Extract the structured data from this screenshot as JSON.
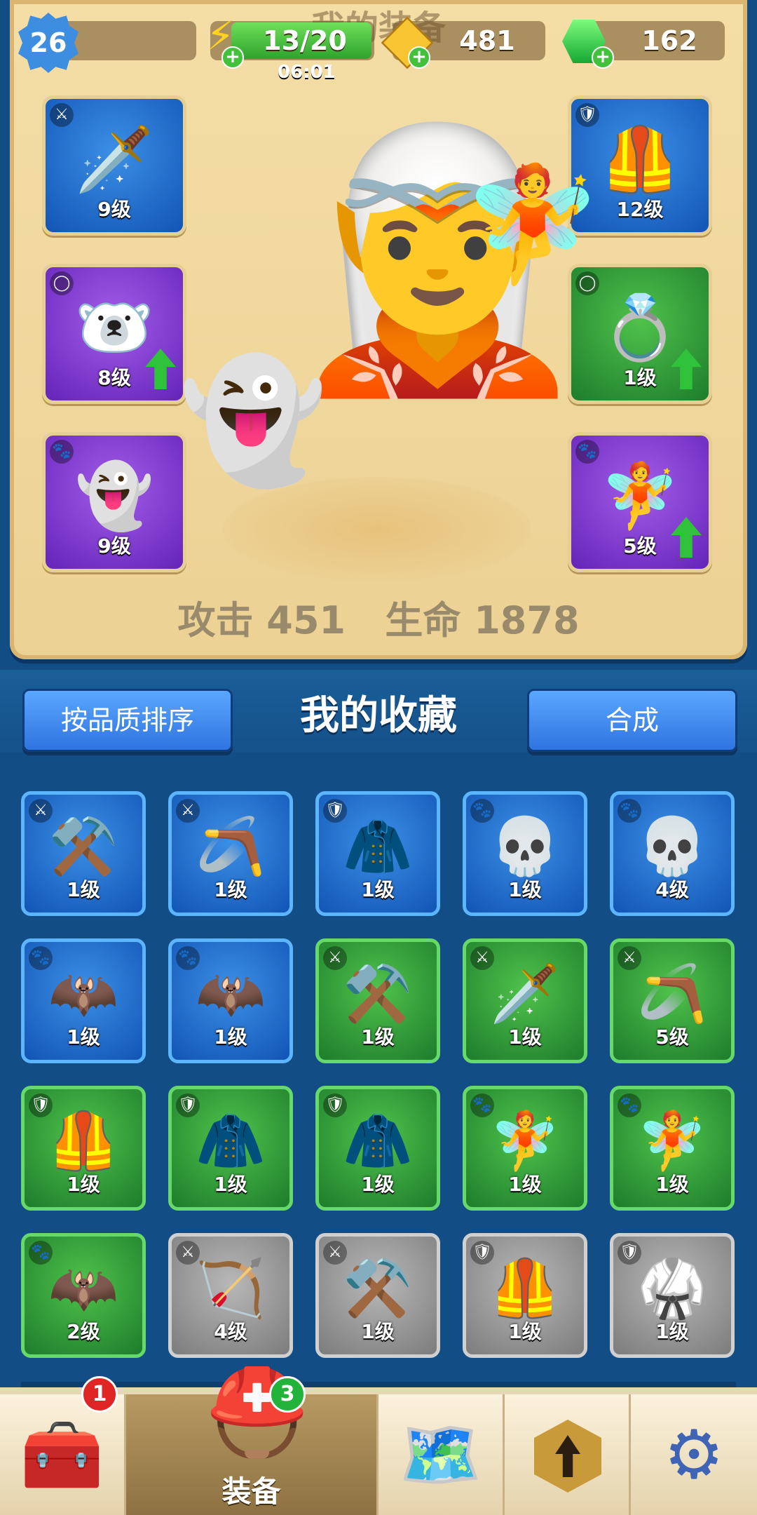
{
  "page_title": "我的装备",
  "hud": {
    "player_level": "26",
    "energy": "13/20",
    "energy_timer": "06:01",
    "gold": "481",
    "gems": "162"
  },
  "equipped": {
    "left": [
      {
        "icon": "sword-icon",
        "glyph": "🗡️",
        "type_glyph": "⚔",
        "level": "9级",
        "quality": "blue",
        "upgrade": false
      },
      {
        "icon": "bear-ring-icon",
        "glyph": "🐻‍❄️",
        "type_glyph": "◯",
        "level": "8级",
        "quality": "purple",
        "upgrade": true
      },
      {
        "icon": "reaper-pet-icon",
        "glyph": "👻",
        "type_glyph": "🐾",
        "level": "9级",
        "quality": "purple",
        "upgrade": false
      }
    ],
    "right": [
      {
        "icon": "gold-armor-icon",
        "glyph": "🦺",
        "type_glyph": "🛡",
        "level": "12级",
        "quality": "blue",
        "upgrade": false
      },
      {
        "icon": "eagle-ring-icon",
        "glyph": "💍",
        "type_glyph": "◯",
        "level": "1级",
        "quality": "green",
        "upgrade": true
      },
      {
        "icon": "fairy-pet-icon",
        "glyph": "🧚",
        "type_glyph": "🐾",
        "level": "5级",
        "quality": "purple",
        "upgrade": true
      }
    ]
  },
  "stats": {
    "attack_label": "攻击",
    "attack_value": "451",
    "hp_label": "生命",
    "hp_value": "1878"
  },
  "collection": {
    "sort_button": "按品质排序",
    "title": "我的收藏",
    "combine_button": "合成",
    "items": [
      {
        "icon": "scythe-icon",
        "glyph": "⚒️",
        "type_glyph": "⚔",
        "level": "1级",
        "quality": "blue"
      },
      {
        "icon": "boomerang-icon",
        "glyph": "🪃",
        "type_glyph": "⚔",
        "level": "1级",
        "quality": "blue"
      },
      {
        "icon": "cape-armor-icon",
        "glyph": "🧥",
        "type_glyph": "🛡",
        "level": "1级",
        "quality": "blue"
      },
      {
        "icon": "bomb-ghost-icon",
        "glyph": "💀",
        "type_glyph": "🐾",
        "level": "1级",
        "quality": "blue"
      },
      {
        "icon": "bomb-ghost-icon",
        "glyph": "💀",
        "type_glyph": "🐾",
        "level": "4级",
        "quality": "blue"
      },
      {
        "icon": "bat-eye-icon",
        "glyph": "🦇",
        "type_glyph": "🐾",
        "level": "1级",
        "quality": "blue"
      },
      {
        "icon": "bat-eye-icon",
        "glyph": "🦇",
        "type_glyph": "🐾",
        "level": "1级",
        "quality": "blue"
      },
      {
        "icon": "scythe-icon",
        "glyph": "⚒️",
        "type_glyph": "⚔",
        "level": "1级",
        "quality": "green"
      },
      {
        "icon": "sword-icon",
        "glyph": "🗡️",
        "type_glyph": "⚔",
        "level": "1级",
        "quality": "green"
      },
      {
        "icon": "boomerang-icon",
        "glyph": "🪃",
        "type_glyph": "⚔",
        "level": "5级",
        "quality": "green"
      },
      {
        "icon": "leather-vest-icon",
        "glyph": "🦺",
        "type_glyph": "🛡",
        "level": "1级",
        "quality": "green"
      },
      {
        "icon": "cape-armor-icon",
        "glyph": "🧥",
        "type_glyph": "🛡",
        "level": "1级",
        "quality": "green"
      },
      {
        "icon": "cape-armor-icon",
        "glyph": "🧥",
        "type_glyph": "🛡",
        "level": "1级",
        "quality": "green"
      },
      {
        "icon": "fairy-pet-icon",
        "glyph": "🧚",
        "type_glyph": "🐾",
        "level": "1级",
        "quality": "green"
      },
      {
        "icon": "fairy-pet-icon",
        "glyph": "🧚",
        "type_glyph": "🐾",
        "level": "1级",
        "quality": "green"
      },
      {
        "icon": "bat-eye-icon",
        "glyph": "🦇",
        "type_glyph": "🐾",
        "level": "2级",
        "quality": "green"
      },
      {
        "icon": "bow-icon",
        "glyph": "🏹",
        "type_glyph": "⚔",
        "level": "4级",
        "quality": "gray"
      },
      {
        "icon": "scythe-icon",
        "glyph": "⚒️",
        "type_glyph": "⚔",
        "level": "1级",
        "quality": "gray"
      },
      {
        "icon": "gold-armor-icon",
        "glyph": "🦺",
        "type_glyph": "🛡",
        "level": "1级",
        "quality": "gray"
      },
      {
        "icon": "mage-robe-icon",
        "glyph": "🥋",
        "type_glyph": "🛡",
        "level": "1级",
        "quality": "gray"
      }
    ]
  },
  "nav": {
    "chest_badge": "1",
    "equipment_label": "装备",
    "equipment_badge": "3"
  },
  "colors": {
    "blue": "#1e6fd1",
    "purple": "#7b33d0",
    "green": "#2b9a36",
    "gray": "#9a9a9a"
  }
}
